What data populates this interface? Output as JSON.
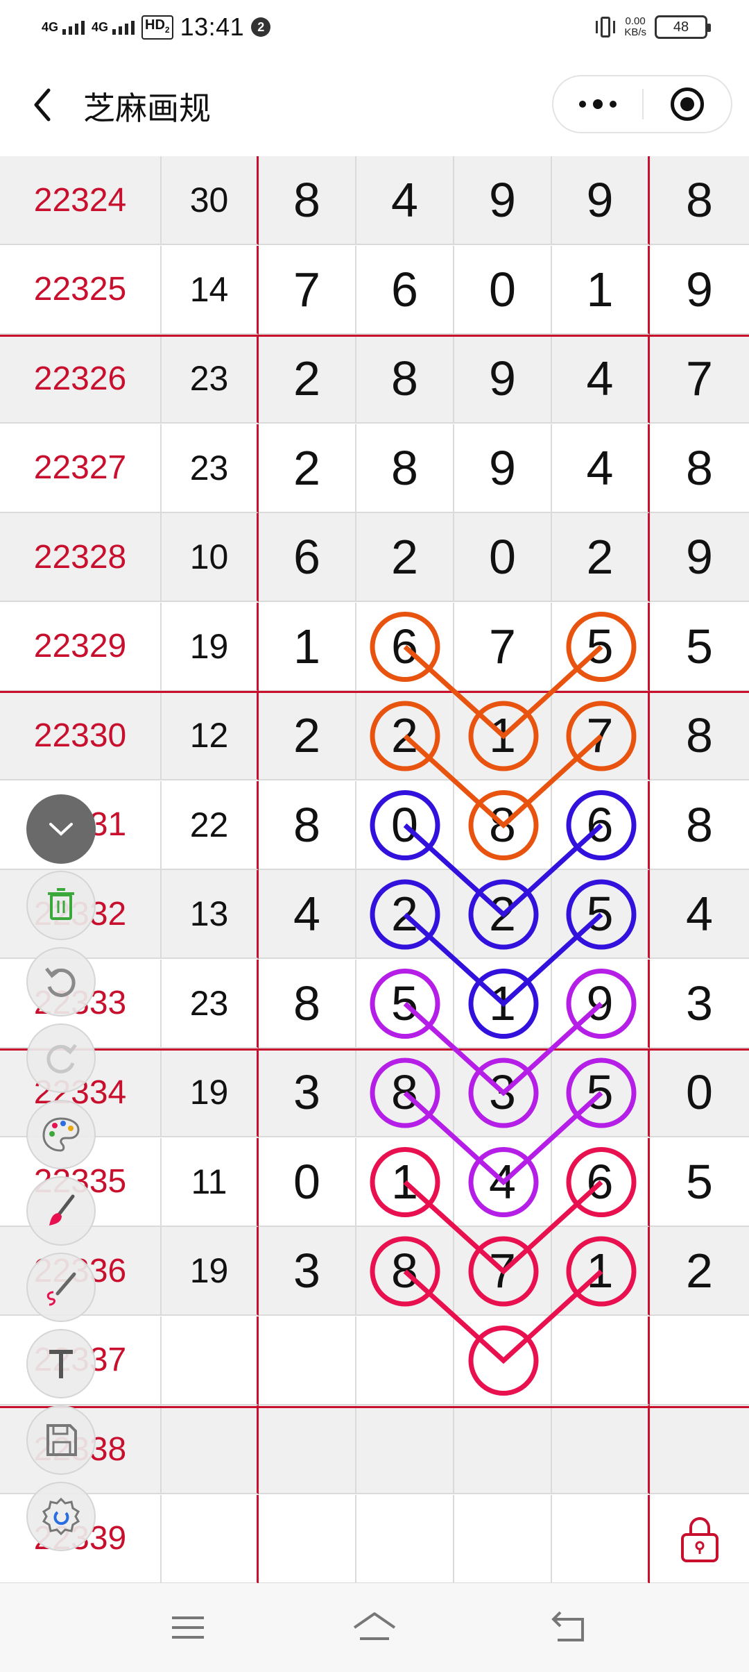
{
  "status_bar": {
    "signal1": "4G",
    "signal2": "4G",
    "hd_badge": "HD",
    "hd_sub": "2",
    "time": "13:41",
    "notif_count": "2",
    "net_speed_value": "0.00",
    "net_speed_unit": "KB/s",
    "battery": "48"
  },
  "nav": {
    "title": "芝麻画规"
  },
  "table": {
    "rows": [
      {
        "id": "22324",
        "sum": "30",
        "d": [
          "8",
          "4",
          "9",
          "9"
        ],
        "last": "8"
      },
      {
        "id": "22325",
        "sum": "14",
        "d": [
          "7",
          "6",
          "0",
          "1"
        ],
        "last": "9"
      },
      {
        "id": "22326",
        "sum": "23",
        "d": [
          "2",
          "8",
          "9",
          "4"
        ],
        "last": "7"
      },
      {
        "id": "22327",
        "sum": "23",
        "d": [
          "2",
          "8",
          "9",
          "4"
        ],
        "last": "8"
      },
      {
        "id": "22328",
        "sum": "10",
        "d": [
          "6",
          "2",
          "0",
          "2"
        ],
        "last": "9"
      },
      {
        "id": "22329",
        "sum": "19",
        "d": [
          "1",
          "6",
          "7",
          "5"
        ],
        "last": "5"
      },
      {
        "id": "22330",
        "sum": "12",
        "d": [
          "2",
          "2",
          "1",
          "7"
        ],
        "last": "8"
      },
      {
        "id": "22331",
        "sum": "22",
        "d": [
          "8",
          "0",
          "8",
          "6"
        ],
        "last": "8"
      },
      {
        "id": "22332",
        "sum": "13",
        "d": [
          "4",
          "2",
          "2",
          "5"
        ],
        "last": "4"
      },
      {
        "id": "22333",
        "sum": "23",
        "d": [
          "8",
          "5",
          "1",
          "9"
        ],
        "last": "3"
      },
      {
        "id": "22334",
        "sum": "19",
        "d": [
          "3",
          "8",
          "3",
          "5"
        ],
        "last": "0"
      },
      {
        "id": "22335",
        "sum": "11",
        "d": [
          "0",
          "1",
          "4",
          "6"
        ],
        "last": "5"
      },
      {
        "id": "22336",
        "sum": "19",
        "d": [
          "3",
          "8",
          "7",
          "1"
        ],
        "last": "2"
      },
      {
        "id": "22337",
        "sum": "",
        "d": [
          "",
          "",
          "",
          ""
        ],
        "last": ""
      },
      {
        "id": "22338",
        "sum": "",
        "d": [
          "",
          "",
          "",
          ""
        ],
        "last": ""
      },
      {
        "id": "22339",
        "sum": "",
        "d": [
          "",
          "",
          "",
          ""
        ],
        "last": ""
      }
    ]
  },
  "drawing": {
    "colors": {
      "orange": "#e8540f",
      "blue": "#3311dd",
      "purple": "#b41ee6",
      "crimson": "#e8104e"
    }
  },
  "toolbar": {
    "items": [
      "collapse",
      "clear-trash",
      "undo",
      "redo",
      "palette",
      "brush",
      "pen",
      "text",
      "save",
      "settings"
    ]
  },
  "colors": {
    "accent_red": "#c8102e",
    "grid_line": "#dadada",
    "shade_row": "#f0f0f0"
  }
}
